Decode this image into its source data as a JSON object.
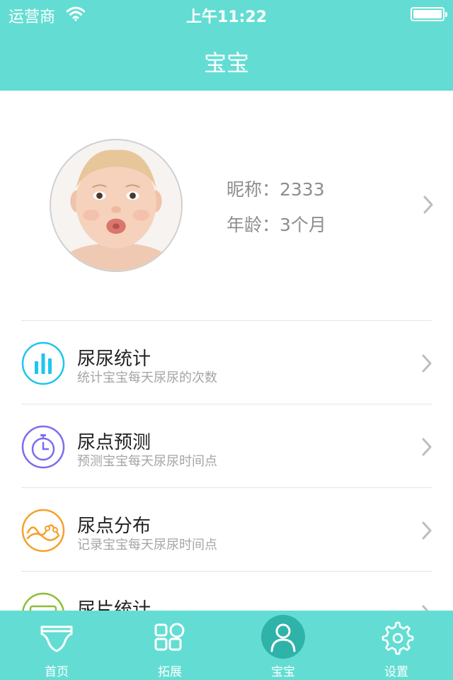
{
  "status_bar": {
    "carrier": "运营商",
    "time": "上午11:22",
    "wifi_icon": "wifi-icon",
    "battery_icon": "battery-icon"
  },
  "nav": {
    "title": "宝宝"
  },
  "profile": {
    "nickname": "昵称：2333",
    "age": "年龄：3个月"
  },
  "menu": {
    "items": [
      {
        "title": "尿尿统计",
        "subtitle": "统计宝宝每天尿尿的次数",
        "icon": "bar-chart-icon",
        "color": "#1ec5ee"
      },
      {
        "title": "尿点预测",
        "subtitle": "预测宝宝每天尿尿时间点",
        "icon": "stopwatch-icon",
        "color": "#7b6cf0"
      },
      {
        "title": "尿点分布",
        "subtitle": "记录宝宝每天尿尿时间点",
        "icon": "wave-chart-icon",
        "color": "#f5a12a"
      },
      {
        "title": "尿片统计",
        "subtitle": "",
        "icon": "diaper-count-icon",
        "color": "#8bbf35"
      }
    ]
  },
  "tabbar": {
    "tabs": [
      {
        "label": "首页",
        "icon": "diaper-icon"
      },
      {
        "label": "拓展",
        "icon": "apps-icon"
      },
      {
        "label": "宝宝",
        "icon": "person-icon",
        "active": true
      },
      {
        "label": "设置",
        "icon": "gear-icon"
      }
    ]
  },
  "colors": {
    "brand": "#63ddd3",
    "active_tab": "#2fb3a8"
  }
}
